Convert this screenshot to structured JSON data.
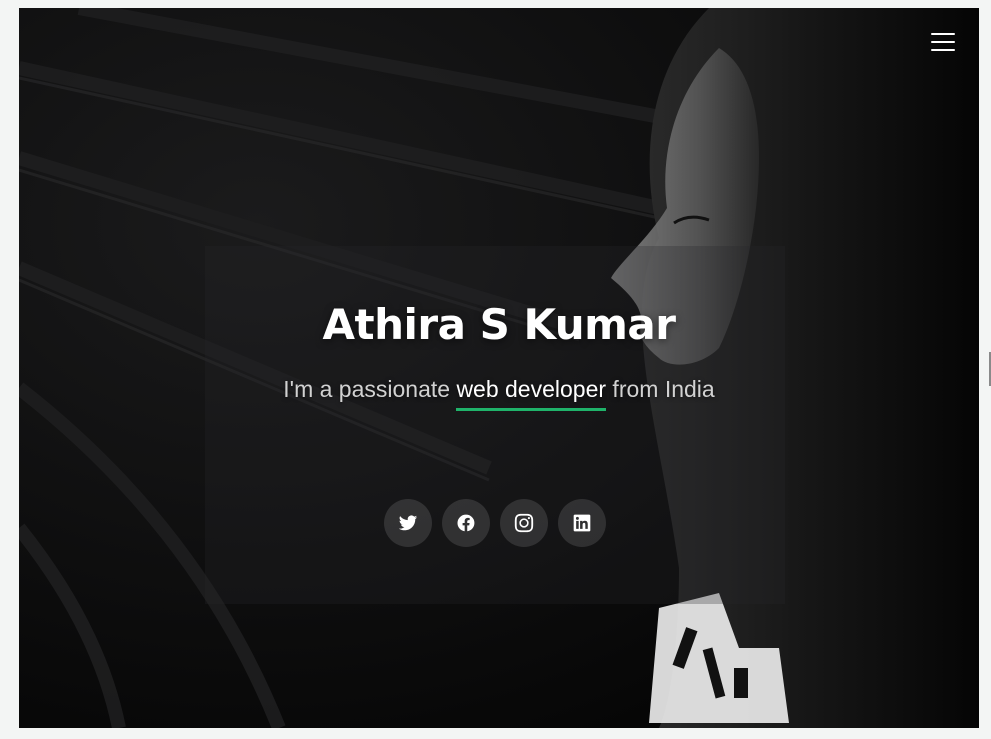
{
  "hero": {
    "name": "Athira S Kumar",
    "subtitle_prefix": "I'm a passionate ",
    "subtitle_highlight": "web developer",
    "subtitle_suffix": " from India"
  },
  "nav": {
    "menu_icon": "hamburger-menu-icon"
  },
  "social": [
    {
      "network": "twitter",
      "icon": "twitter-icon"
    },
    {
      "network": "facebook",
      "icon": "facebook-icon"
    },
    {
      "network": "instagram",
      "icon": "instagram-icon"
    },
    {
      "network": "linkedin",
      "icon": "linkedin-icon"
    }
  ],
  "colors": {
    "accent": "#1fb36a",
    "background": "#0b0b0c",
    "text": "#ffffff"
  }
}
